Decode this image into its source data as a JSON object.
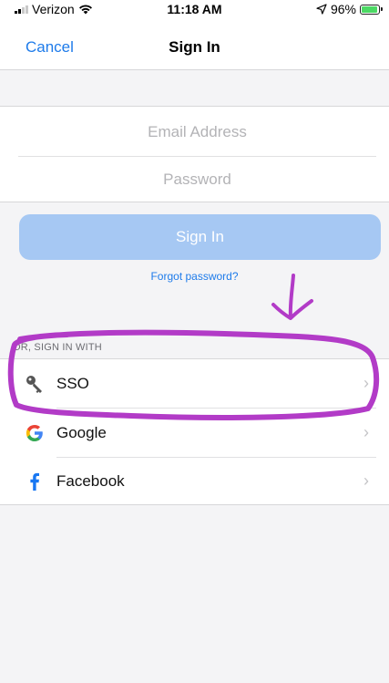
{
  "status_bar": {
    "carrier": "Verizon",
    "time": "11:18 AM",
    "battery_percent": "96%"
  },
  "nav": {
    "cancel_label": "Cancel",
    "title": "Sign In"
  },
  "form": {
    "email_placeholder": "Email Address",
    "email_value": "",
    "password_placeholder": "Password",
    "password_value": ""
  },
  "signin_button_label": "Sign In",
  "forgot_password_label": "Forgot password?",
  "alt_signin": {
    "section_header": "OR, SIGN IN WITH",
    "options": [
      {
        "label": "SSO",
        "icon": "key-icon"
      },
      {
        "label": "Google",
        "icon": "google-icon"
      },
      {
        "label": "Facebook",
        "icon": "facebook-icon"
      }
    ]
  },
  "colors": {
    "accent": "#1e7bea",
    "signin_button_disabled": "#a6c8f3",
    "annotation": "#b23bc7",
    "background": "#f4f4f6"
  }
}
